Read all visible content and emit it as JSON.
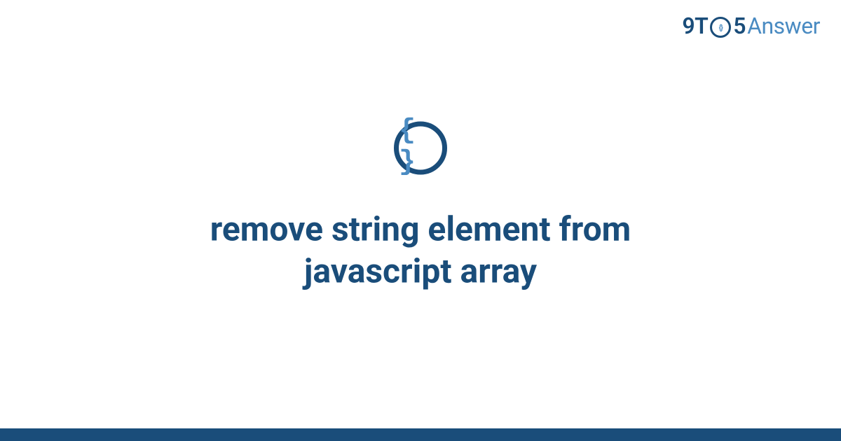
{
  "header": {
    "logo": {
      "left": "9T",
      "inner_braces": "{}",
      "five": "5",
      "right": "Answer"
    }
  },
  "main": {
    "category_icon_braces": "{ }",
    "title": "remove string element from javascript array"
  },
  "colors": {
    "primary_dark": "#1a4d7a",
    "primary_light": "#4a8bc2"
  }
}
